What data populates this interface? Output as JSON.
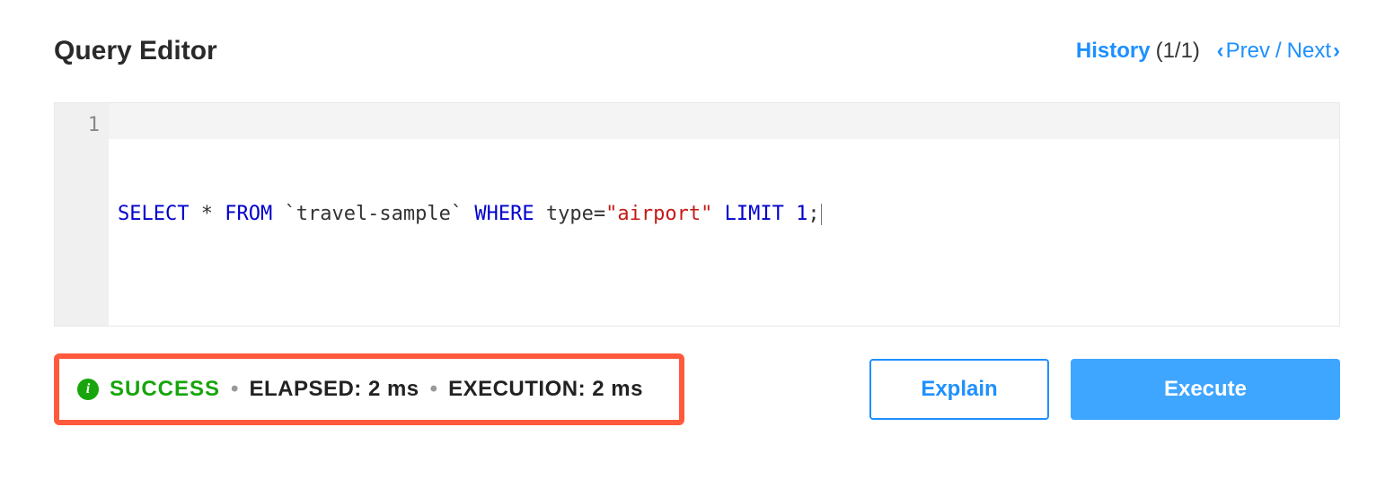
{
  "header": {
    "title": "Query Editor",
    "history_label": "History",
    "history_count": "(1/1)",
    "prev_label": "Prev",
    "next_label": "Next"
  },
  "editor": {
    "line_number": "1",
    "tokens": {
      "select": "SELECT",
      "star": "*",
      "from": "FROM",
      "table": "`travel-sample`",
      "where": "WHERE",
      "column": "type",
      "eq": "=",
      "value": "\"airport\"",
      "limit": "LIMIT",
      "limit_n": "1",
      "semi": ";"
    }
  },
  "status": {
    "success_label": "SUCCESS",
    "elapsed_label": "ELAPSED: 2 ms",
    "execution_label": "EXECUTION: 2 ms"
  },
  "buttons": {
    "explain": "Explain",
    "execute": "Execute"
  }
}
